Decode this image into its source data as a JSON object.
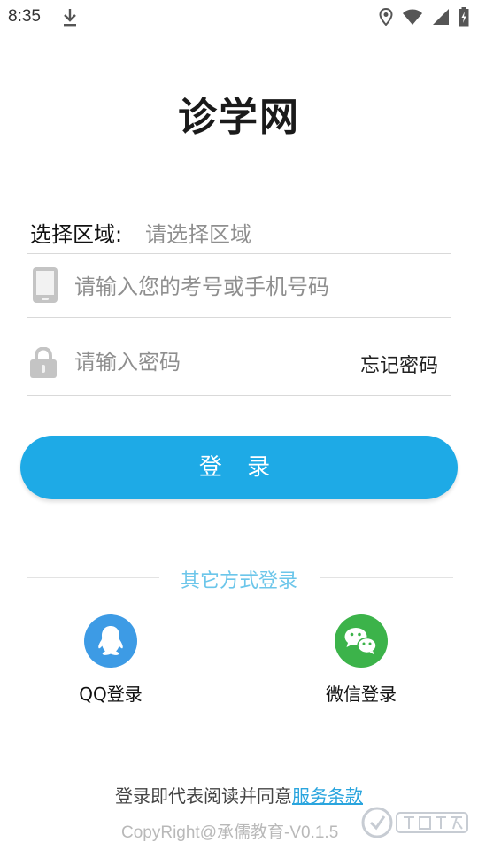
{
  "status_bar": {
    "time": "8:35",
    "icons": [
      "download-icon",
      "location-icon",
      "wifi-icon",
      "signal-icon",
      "battery-charging-icon"
    ]
  },
  "app": {
    "title": "诊学网"
  },
  "form": {
    "region_label": "选择区域:",
    "region_placeholder": "请选择区域",
    "phone_placeholder": "请输入您的考号或手机号码",
    "phone_value": "",
    "password_placeholder": "请输入密码",
    "password_value": "",
    "forgot_password": "忘记密码"
  },
  "login_button": "登 录",
  "other_methods": {
    "title": "其它方式登录",
    "qq_label": "QQ登录",
    "wechat_label": "微信登录"
  },
  "footer": {
    "agreement_prefix": "登录即代表阅读并同意",
    "terms_link": "服务条款",
    "copyright": "CopyRight@承儒教育-V0.1.5"
  },
  "colors": {
    "accent": "#1eaae6",
    "other_title": "#6cc6ea",
    "qq": "#3d9be5",
    "wechat": "#3cb34a"
  }
}
